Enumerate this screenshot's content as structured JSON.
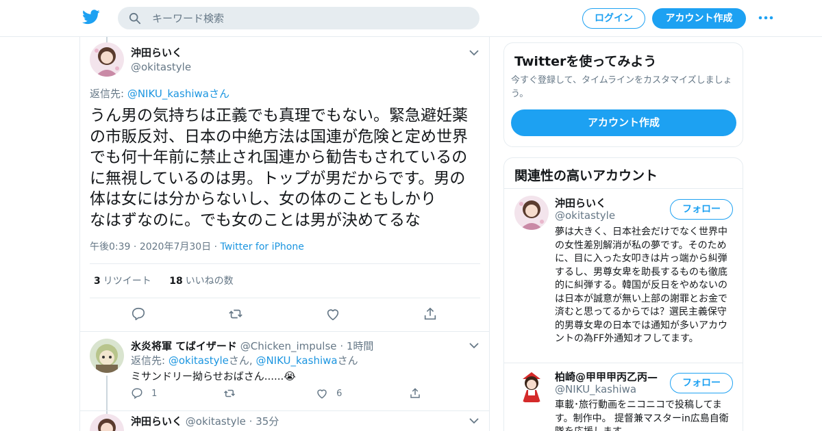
{
  "header": {
    "search_placeholder": "キーワード検索",
    "login_label": "ログイン",
    "signup_label": "アカウント作成",
    "brand_color": "#1da1f2"
  },
  "tweet": {
    "display_name": "沖田らいく",
    "handle": "@okitastyle",
    "reply_prefix": "返信先: ",
    "reply_link": "@NIKU_kashiwa",
    "reply_suffix": "さん",
    "text_lines": [
      "うん男の気持ちは正義でも真理でもない。緊急避妊薬",
      "の市販反対、日本の中絶方法は国連が危険と定め世界",
      "でも何十年前に禁止され国連から勧告もされているの",
      "に無視しているのは男。トップが男だからです。男の",
      "体は女には分からないし、女の体のこともしかり",
      "なはずなのに。でも女のことは男が決めてるな"
    ],
    "time": "午後0:39",
    "date": "2020年7月30日",
    "source": "Twitter for iPhone",
    "retweet_count": "3",
    "retweet_label": "リツイート",
    "like_count": "18",
    "like_label": "いいねの数"
  },
  "replies": [
    {
      "display_name": "氷炎将軍 てばイザード",
      "handle": "@Chicken_impulse",
      "time": "1時間",
      "reply_prefix": "返信先: ",
      "reply_link1": "@okitastyle",
      "reply_mid": "さん, ",
      "reply_link2": "@NIKU_kashiwa",
      "reply_suffix": "さん",
      "text": "ミサンドリー拗らせおばさん......😭",
      "reply_count": "1",
      "like_count": "6"
    },
    {
      "display_name": "沖田らいく",
      "handle": "@okitastyle",
      "time": "35分"
    }
  ],
  "sidebar": {
    "try_title": "Twitterを使ってみよう",
    "try_sub": "今すぐ登録して、タイムラインをカスタマイズしましょう。",
    "try_button": "アカウント作成",
    "related_title": "関連性の高いアカウント",
    "accounts": [
      {
        "name": "沖田らいく",
        "handle": "@okitastyle",
        "follow": "フォロー",
        "bio": "夢は大きく、日本社会だけでなく世界中の女性差別解消が私の夢です。そのために、目に入った女叩きは片っ端から糾弾するし、男尊女卑を助長するものも徹底的に糾弾する。韓国が反日をやめないのは日本が誠意が無い上部の謝罪とお金で済むと思ってるからでは？選民主義保守的男尊女卑の日本では通知が多いアカウントの為FF外通知オフしてます。"
      },
      {
        "name": "柏崎@甲甲甲丙乙丙—",
        "handle": "@NIKU_kashiwa",
        "follow": "フォロー",
        "bio": "車載･旅行動画をニコニコで投稿してます。制作中。 提督兼マスターin広島自衛隊を応援します"
      }
    ]
  }
}
